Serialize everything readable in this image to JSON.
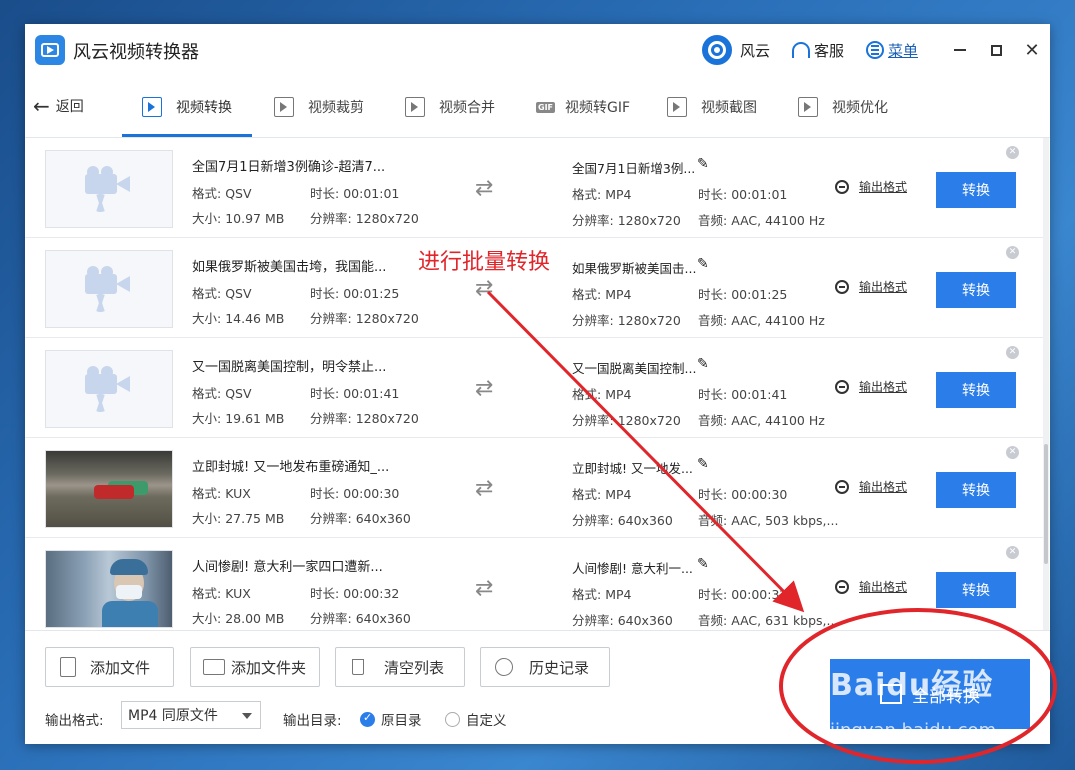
{
  "app": {
    "title": "风云视频转换器"
  },
  "titlebar": {
    "brand": "风云",
    "service": "客服",
    "menu": "菜单"
  },
  "nav": {
    "back": "返回",
    "tabs": [
      {
        "label": "视频转换",
        "active": true
      },
      {
        "label": "视频裁剪"
      },
      {
        "label": "视频合并"
      },
      {
        "label": "视频转GIF",
        "badge": "GIF"
      },
      {
        "label": "视频截图"
      },
      {
        "label": "视频优化"
      }
    ]
  },
  "labels": {
    "format": "格式:",
    "duration": "时长:",
    "size": "大小:",
    "resolution": "分辨率:",
    "audio": "音频:",
    "output_format_link": "输出格式",
    "convert": "转换"
  },
  "files": [
    {
      "thumb": "camera-placeholder",
      "in_title": "全国7月1日新增3例确诊-超清7...",
      "in_format": "QSV",
      "in_duration": "00:01:01",
      "in_size": "10.97 MB",
      "in_resolution": "1280x720",
      "out_title": "全国7月1日新增3例...",
      "out_format": "MP4",
      "out_duration": "00:01:01",
      "out_resolution": "1280x720",
      "out_audio": "AAC, 44100 Hz"
    },
    {
      "thumb": "camera-placeholder",
      "in_title": "如果俄罗斯被美国击垮，我国能...",
      "in_format": "QSV",
      "in_duration": "00:01:25",
      "in_size": "14.46 MB",
      "in_resolution": "1280x720",
      "out_title": "如果俄罗斯被美国击...",
      "out_format": "MP4",
      "out_duration": "00:01:25",
      "out_resolution": "1280x720",
      "out_audio": "AAC, 44100 Hz"
    },
    {
      "thumb": "camera-placeholder",
      "in_title": "又一国脱离美国控制，明令禁止...",
      "in_format": "QSV",
      "in_duration": "00:01:41",
      "in_size": "19.61 MB",
      "in_resolution": "1280x720",
      "out_title": "又一国脱离美国控制...",
      "out_format": "MP4",
      "out_duration": "00:01:41",
      "out_resolution": "1280x720",
      "out_audio": "AAC, 44100 Hz"
    },
    {
      "thumb": "street-photo",
      "in_title": "立即封城! 又一地发布重磅通知_...",
      "in_format": "KUX",
      "in_duration": "00:00:30",
      "in_size": "27.75 MB",
      "in_resolution": "640x360",
      "out_title": "立即封城! 又一地发...",
      "out_format": "MP4",
      "out_duration": "00:00:30",
      "out_resolution": "640x360",
      "out_audio": "AAC, 503 kbps,..."
    },
    {
      "thumb": "doctor-photo",
      "in_title": "人间惨剧! 意大利一家四口遭新...",
      "in_format": "KUX",
      "in_duration": "00:00:32",
      "in_size": "28.00 MB",
      "in_resolution": "640x360",
      "out_title": "人间惨剧! 意大利一...",
      "out_format": "MP4",
      "out_duration": "00:00:32",
      "out_resolution": "640x360",
      "out_audio": "AAC, 631 kbps,..."
    }
  ],
  "bottom": {
    "add_file": "添加文件",
    "add_folder": "添加文件夹",
    "clear_list": "清空列表",
    "history": "历史记录",
    "output_format_label": "输出格式:",
    "output_format_value": "MP4 同原文件",
    "output_dir_label": "输出目录:",
    "dir_original": "原目录",
    "dir_custom": "自定义",
    "dir_selected": "原目录",
    "convert_all": "全部转换"
  },
  "annotation": {
    "text": "进行批量转换",
    "color": "#e0262b"
  },
  "watermark": {
    "main": "Baidu经验",
    "sub": "jingyan.baidu.com"
  },
  "colors": {
    "accent": "#2b7de9",
    "annotation": "#e0262b"
  }
}
